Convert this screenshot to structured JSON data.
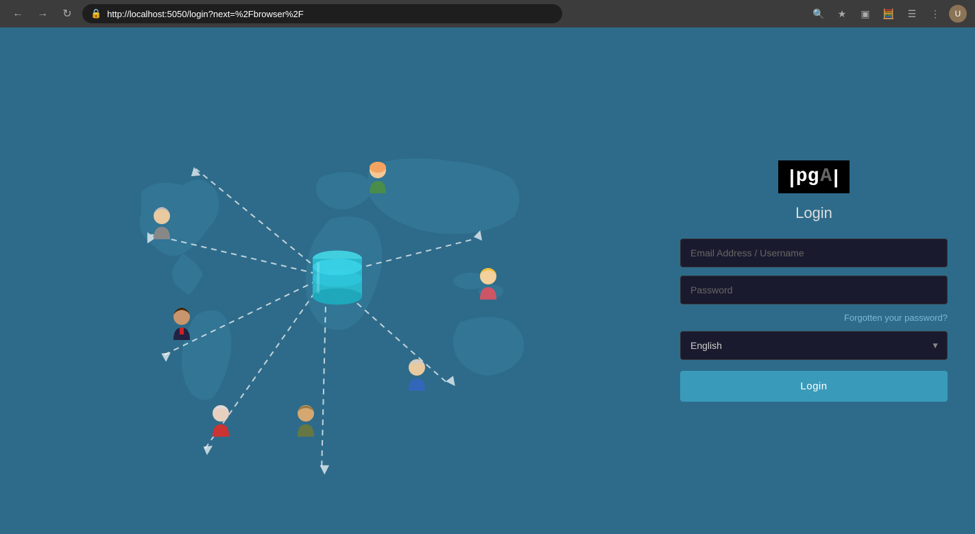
{
  "browser": {
    "url": "http://localhost:5050/login?next=%2Fbrowser%2F",
    "back_title": "Back",
    "forward_title": "Forward",
    "reload_title": "Reload"
  },
  "logo": {
    "bracket_left": "|",
    "pg_text": "pg",
    "admin_text": "A",
    "bracket_right": "|"
  },
  "login_form": {
    "title": "Login",
    "email_placeholder": "Email Address / Username",
    "password_placeholder": "Password",
    "forgot_password_label": "Forgotten your password?",
    "language_value": "English",
    "language_options": [
      "English"
    ],
    "login_button_label": "Login"
  }
}
